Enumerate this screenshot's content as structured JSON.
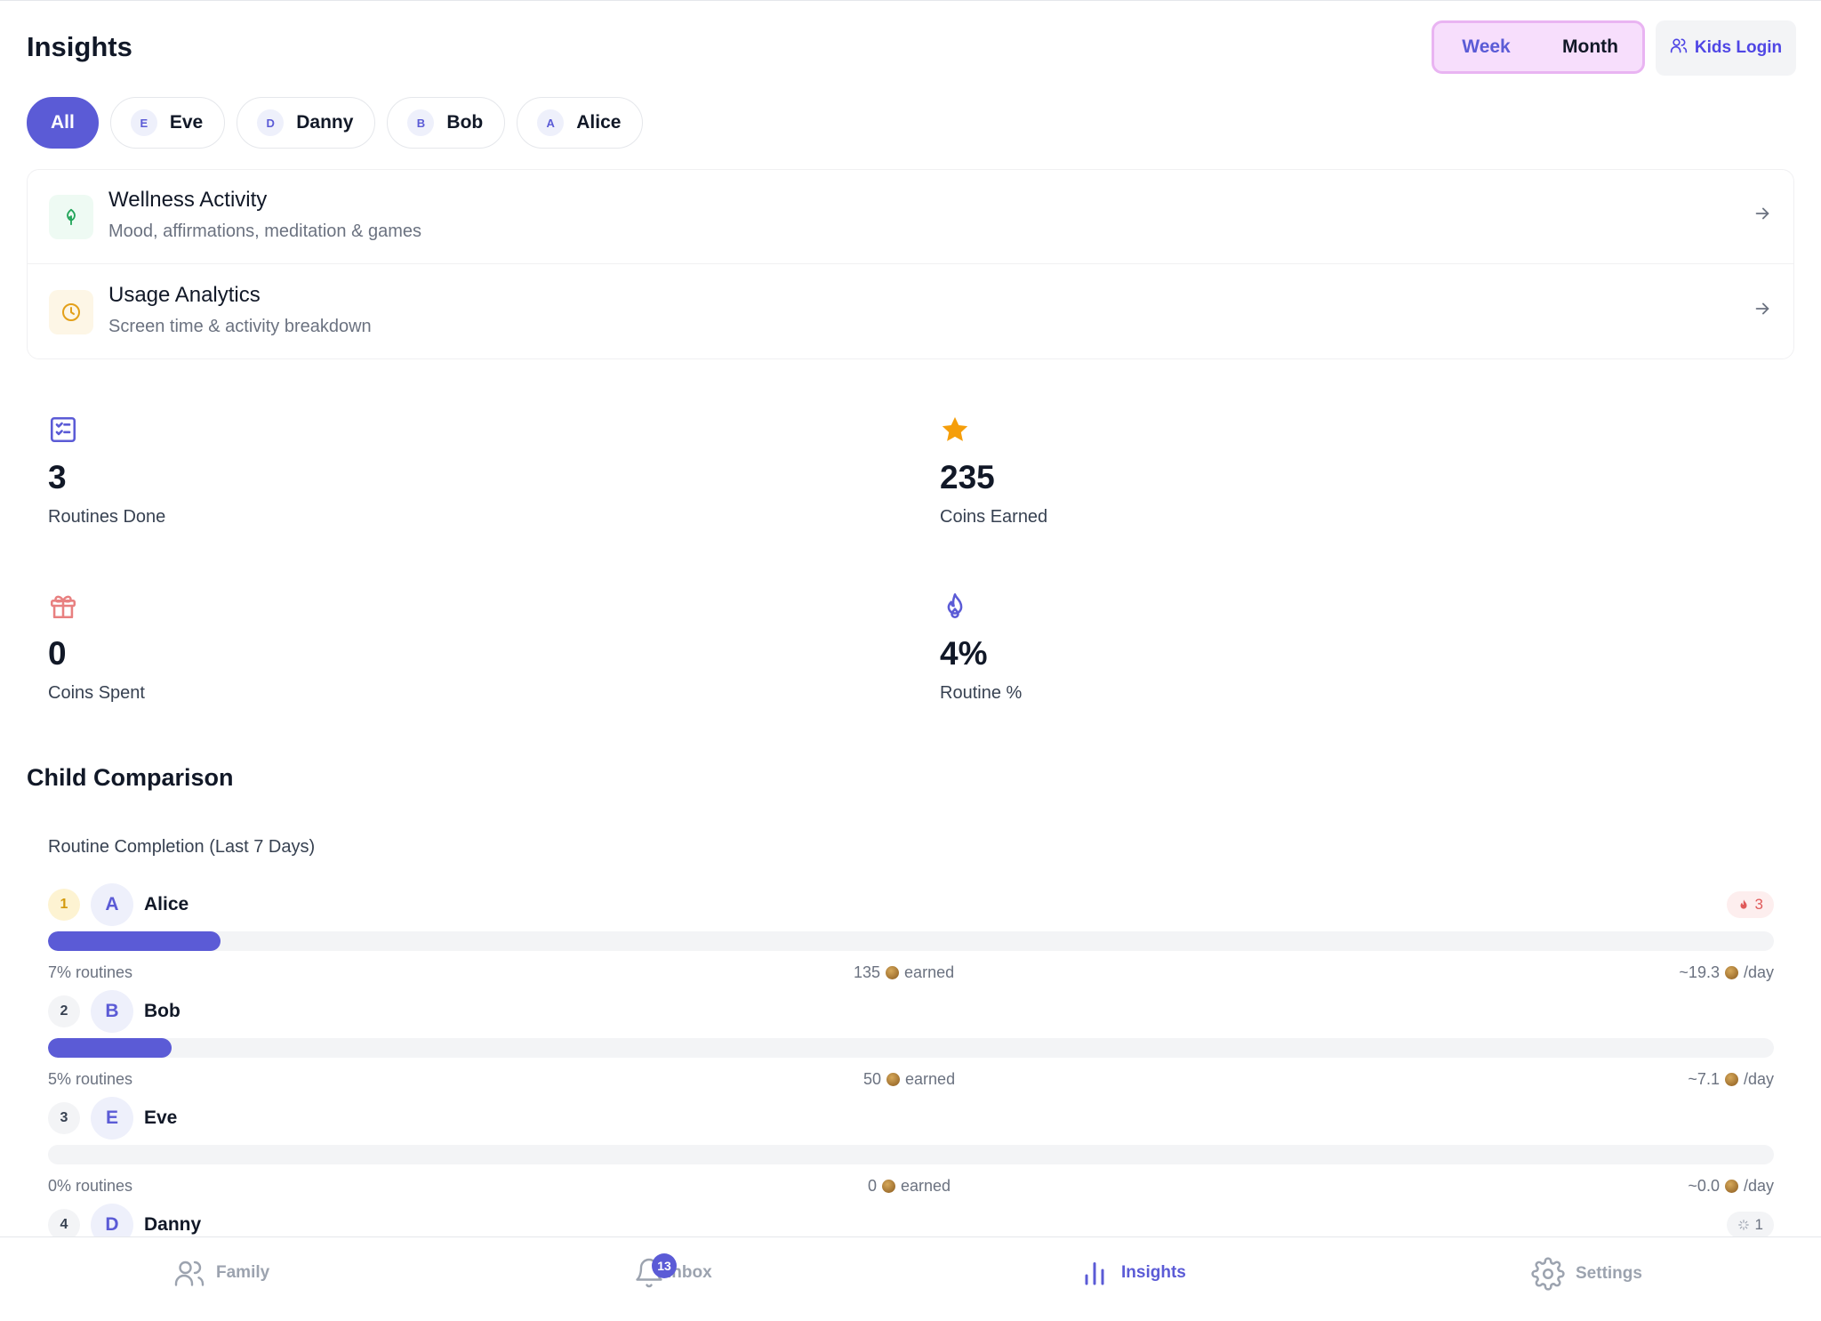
{
  "header": {
    "title": "Insights",
    "period": {
      "week_label": "Week",
      "month_label": "Month",
      "selected": "Week"
    },
    "kids_login_label": "Kids Login"
  },
  "filters": {
    "all_label": "All",
    "children": [
      {
        "initial": "E",
        "name": "Eve"
      },
      {
        "initial": "D",
        "name": "Danny"
      },
      {
        "initial": "B",
        "name": "Bob"
      },
      {
        "initial": "A",
        "name": "Alice"
      }
    ]
  },
  "nav_cards": [
    {
      "title": "Wellness Activity",
      "subtitle": "Mood, affirmations, meditation & games",
      "icon": "sprout-icon"
    },
    {
      "title": "Usage Analytics",
      "subtitle": "Screen time & activity breakdown",
      "icon": "clock-icon"
    }
  ],
  "stats": {
    "routines_done": {
      "value": "3",
      "label": "Routines Done"
    },
    "coins_earned": {
      "value": "235",
      "label": "Coins Earned"
    },
    "coins_spent": {
      "value": "0",
      "label": "Coins Spent"
    },
    "routine_pct": {
      "value": "4%",
      "label": "Routine %"
    }
  },
  "comparison": {
    "title": "Child Comparison",
    "subtitle": "Routine Completion (Last 7 Days)",
    "earned_suffix": "earned",
    "per_day_suffix": "/day",
    "rows": [
      {
        "rank": "1",
        "initial": "A",
        "name": "Alice",
        "badge": "3",
        "badge_icon": "flame-icon",
        "progress": 0.07,
        "routines_text": "7% routines",
        "earned": "135",
        "per_day": "~19.3"
      },
      {
        "rank": "2",
        "initial": "B",
        "name": "Bob",
        "badge": "",
        "badge_icon": "",
        "progress": 0.05,
        "routines_text": "5% routines",
        "earned": "50",
        "per_day": "~7.1"
      },
      {
        "rank": "3",
        "initial": "E",
        "name": "Eve",
        "badge": "",
        "badge_icon": "",
        "progress": 0.0,
        "routines_text": "0% routines",
        "earned": "0",
        "per_day": "~0.0"
      },
      {
        "rank": "4",
        "initial": "D",
        "name": "Danny",
        "badge": "1",
        "badge_icon": "sparkle-icon",
        "progress": 0.0,
        "routines_text": "",
        "earned": "",
        "per_day": ""
      }
    ]
  },
  "bottom_nav": {
    "family_label": "Family",
    "inbox_label": "Inbox",
    "inbox_count": "13",
    "insights_label": "Insights",
    "settings_label": "Settings",
    "active": "Insights"
  },
  "colors": {
    "accent": "#5b5bd6",
    "period_bg": "#f7defc",
    "star": "#f59e0b",
    "gift": "#e88080"
  }
}
